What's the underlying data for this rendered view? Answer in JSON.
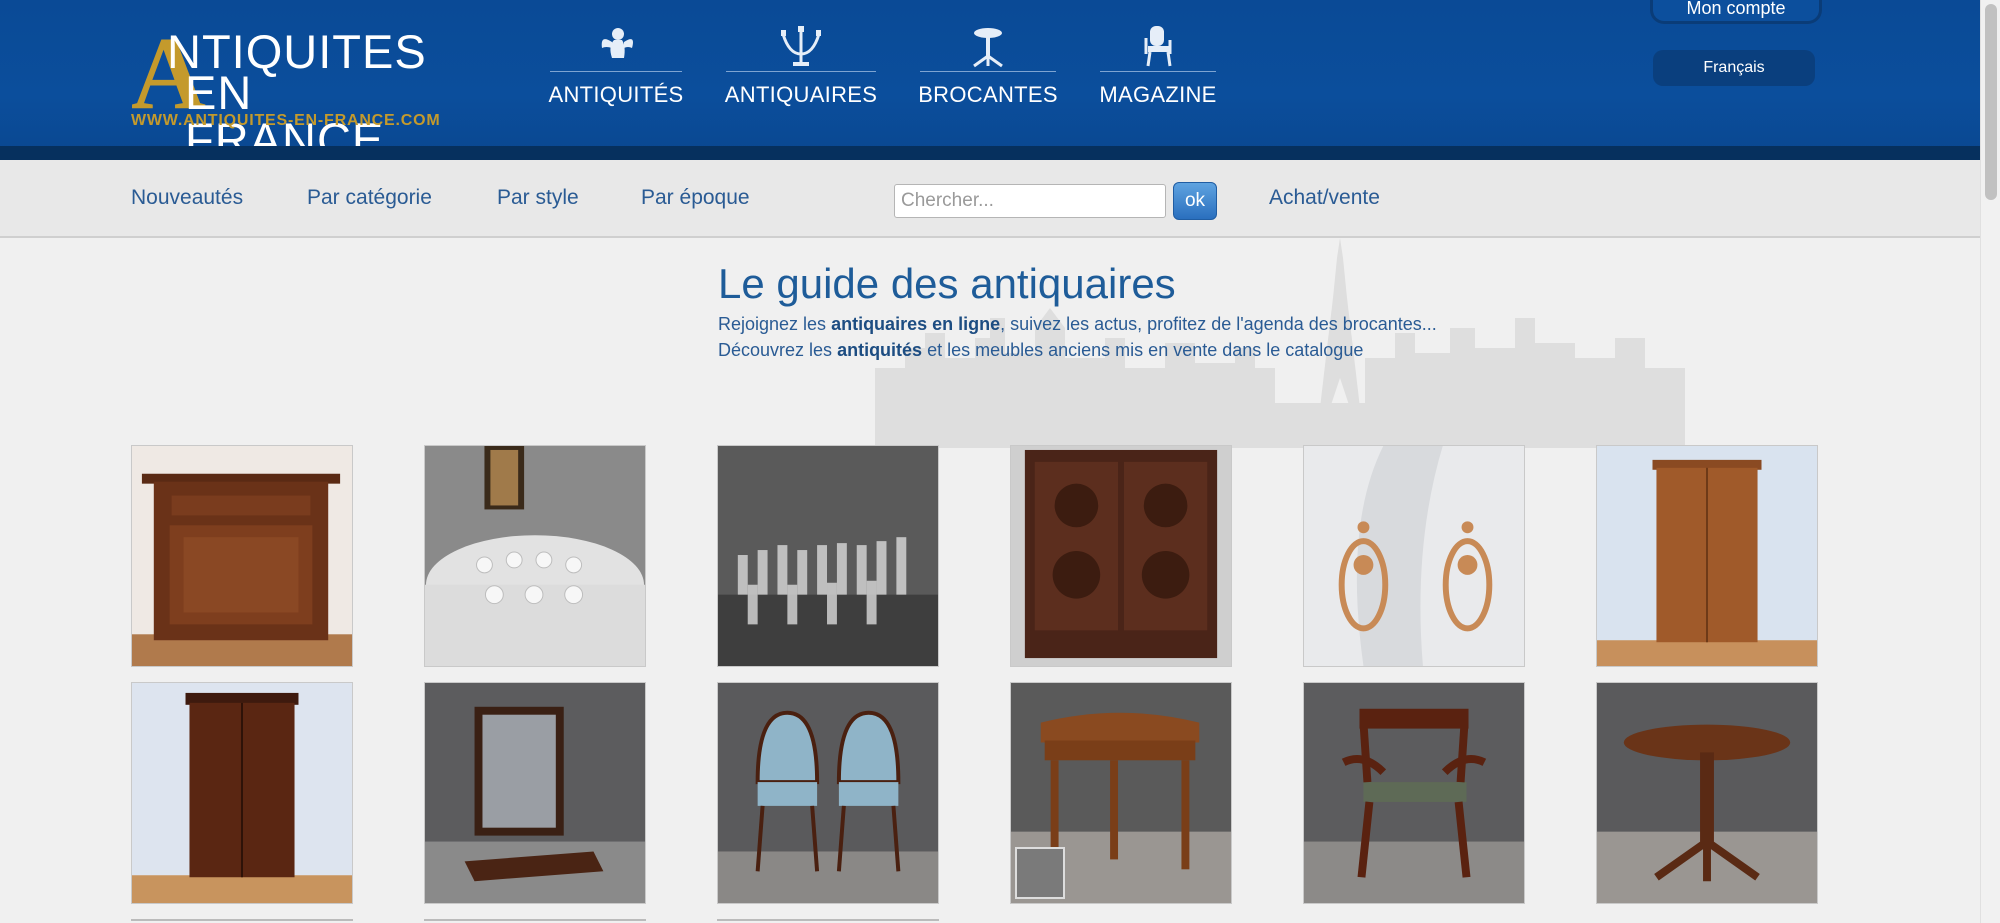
{
  "header": {
    "logo": {
      "line1": "NTIQUITES",
      "big_letter": "A",
      "line2": "EN FRANCE",
      "url": "WWW.ANTIQUITES-EN-FRANCE.COM"
    },
    "main_nav": [
      {
        "label": "ANTIQUITÉS",
        "icon": "cherub-icon"
      },
      {
        "label": "ANTIQUAIRES",
        "icon": "candelabra-icon"
      },
      {
        "label": "BROCANTES",
        "icon": "pedestal-table-icon"
      },
      {
        "label": "MAGAZINE",
        "icon": "armchair-icon"
      }
    ],
    "account_label": "Mon compte",
    "language_label": "Français"
  },
  "subnav": {
    "links": [
      "Nouveautés",
      "Par catégorie",
      "Par style",
      "Par époque"
    ],
    "search_placeholder": "Chercher...",
    "search_button": "ok",
    "buy_sell": "Achat/vente"
  },
  "main": {
    "title": "Le guide des antiquaires",
    "intro_line1": {
      "before": "Rejoignez les ",
      "bold": "antiquaires en ligne",
      "after": ", suivez les actus, profitez de l'agenda des brocantes..."
    },
    "intro_line2": {
      "before": "Découvrez les ",
      "bold": "antiquités",
      "after": " et les meubles anciens mis en vente dans le catalogue"
    }
  },
  "products": [
    {
      "name": "walnut-bedside-cabinet"
    },
    {
      "name": "crystal-glassware-table"
    },
    {
      "name": "crystal-glass-set"
    },
    {
      "name": "carved-oak-cabinet"
    },
    {
      "name": "gold-drop-earrings"
    },
    {
      "name": "cherry-wood-armoire"
    },
    {
      "name": "mahogany-wardrobe"
    },
    {
      "name": "psyche-mirror"
    },
    {
      "name": "pair-of-gondola-chairs"
    },
    {
      "name": "demi-lune-console-table"
    },
    {
      "name": "mahogany-armchair"
    },
    {
      "name": "tripod-pedestal-table"
    }
  ],
  "colors": {
    "header_blue": "#0b4e9c",
    "gold": "#c49a2c",
    "link_blue": "#2a5b94",
    "title_blue": "#1e5c99"
  }
}
